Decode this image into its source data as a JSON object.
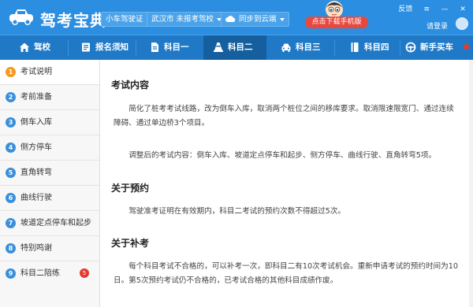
{
  "header": {
    "app_title": "驾考宝典",
    "license_type": "小车驾驶证",
    "location": "武汉市 未报考驾校",
    "sync": "同步到云端",
    "download": "点击下载手机版",
    "feedback": "反馈",
    "login": "请登录"
  },
  "nav": {
    "items": [
      "驾校",
      "报名须知",
      "科目一",
      "科目二",
      "科目三",
      "科目四",
      "新手买车"
    ],
    "active": "科目二"
  },
  "sidebar": {
    "items": [
      {
        "num": "1",
        "label": "考试说明"
      },
      {
        "num": "2",
        "label": "考前准备"
      },
      {
        "num": "3",
        "label": "倒车入库"
      },
      {
        "num": "4",
        "label": "侧方停车"
      },
      {
        "num": "5",
        "label": "直角转弯"
      },
      {
        "num": "6",
        "label": "曲线行驶"
      },
      {
        "num": "7",
        "label": "坡道定点停车和起步"
      },
      {
        "num": "8",
        "label": "特别鸣谢"
      },
      {
        "num": "9",
        "label": "科目二陪练",
        "badge": "5"
      }
    ]
  },
  "content": {
    "sections": [
      {
        "title": "考试内容",
        "paragraphs": [
          "简化了桩考考试线路，改为倒车入库，取消两个桩位之间的移库要求。取消限速限宽门、通过连续障碍、通过单边桥3个项目。",
          "调整后的考试内容：倒车入库、坡道定点停车和起步、侧方停车、曲线行驶、直角转弯5项。"
        ]
      },
      {
        "title": "关于预约",
        "paragraphs": [
          "驾驶准考证明在有效期内，科目二考试的预约次数不得超过5次。"
        ]
      },
      {
        "title": "关于补考",
        "paragraphs": [
          "每个科目考试不合格的，可以补考一次，即科目二有10次考试机会。重新申请考试的预约时间为10日。第5次预约考试仍不合格的，已考试合格的其他科目成绩作废。"
        ]
      }
    ]
  },
  "colors": {
    "header_bg": "#2c8ee0",
    "nav_bg": "#1f79c6",
    "nav_active_bg": "#155f9f",
    "download_btn": "#e8493f",
    "active_step": "#f39a1e",
    "step_circle": "#3a8fdb",
    "badge": "#e53b2e"
  }
}
